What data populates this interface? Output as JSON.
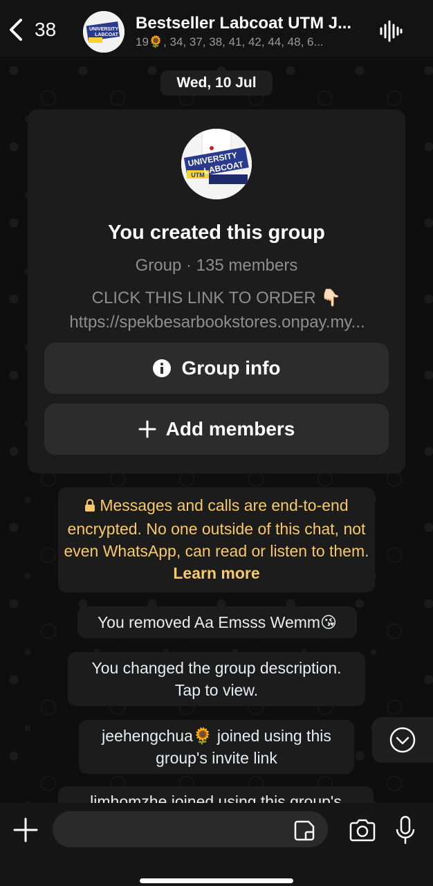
{
  "header": {
    "back_count": "38",
    "title": "Bestseller Labcoat UTM J...",
    "subtitle": "19🌻, 34, 37, 38, 41, 42, 44, 48, 6..."
  },
  "avatar_text": {
    "line1": "UNIVERSITY",
    "line2": "LABCOAT",
    "line3": "UTM"
  },
  "date_chip": "Wed, 10 Jul",
  "group_card": {
    "title": "You created this group",
    "subtitle": "Group · 135 members",
    "description": "CLICK THIS LINK TO ORDER 👇🏻",
    "link": "https://spekbesarbookstores.onpay.my...",
    "group_info_label": "Group info",
    "add_members_label": "Add members"
  },
  "encryption": {
    "text": "Messages and calls are end-to-end encrypted. No one outside of this chat, not even WhatsApp, can read or listen to them.",
    "learn_more": "Learn more"
  },
  "system_messages": {
    "removed": "You removed Aa Emsss Wemm😘",
    "changed_desc_1": "You changed the group description.",
    "changed_desc_2": "Tap to view.",
    "joined_1": "jeehengchua🌻 joined using this",
    "joined_2": "group's invite link",
    "joined_partial": "limhomzhe joined using this group's"
  },
  "composer": {
    "placeholder": ""
  },
  "colors": {
    "encryption_text": "#f6c96a",
    "bubble": "#1c1c1c"
  }
}
